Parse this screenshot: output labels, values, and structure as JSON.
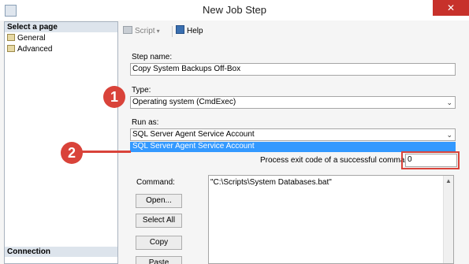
{
  "window": {
    "title": "New Job Step",
    "close_glyph": "✕"
  },
  "left_pane": {
    "select_page_header": "Select a page",
    "pages": [
      {
        "label": "General",
        "icon": "page-icon"
      },
      {
        "label": "Advanced",
        "icon": "page-icon"
      }
    ],
    "connection_header": "Connection"
  },
  "toolbar": {
    "script_label": "Script",
    "script_dropdown_glyph": "▾",
    "help_label": "Help"
  },
  "form": {
    "step_name_label": "Step name:",
    "step_name_value": "Copy System Backups Off-Box",
    "type_label": "Type:",
    "type_value": "Operating system (CmdExec)",
    "run_as_label": "Run as:",
    "run_as_value": "SQL Server Agent Service Account",
    "run_as_dropdown_option": "SQL Server Agent Service Account",
    "exit_code_label": "Process exit code of a successful command:",
    "exit_code_value": "0",
    "command_label": "Command:",
    "command_value": "\"C:\\Scripts\\System Databases.bat\"",
    "buttons": {
      "open": "Open...",
      "select_all": "Select All",
      "copy": "Copy",
      "paste": "Paste"
    },
    "combo_arrow_glyph": "⌄",
    "scroll_up_glyph": "▲"
  },
  "annotations": {
    "badge_1": "1",
    "badge_2": "2",
    "color": "#d9433a"
  }
}
